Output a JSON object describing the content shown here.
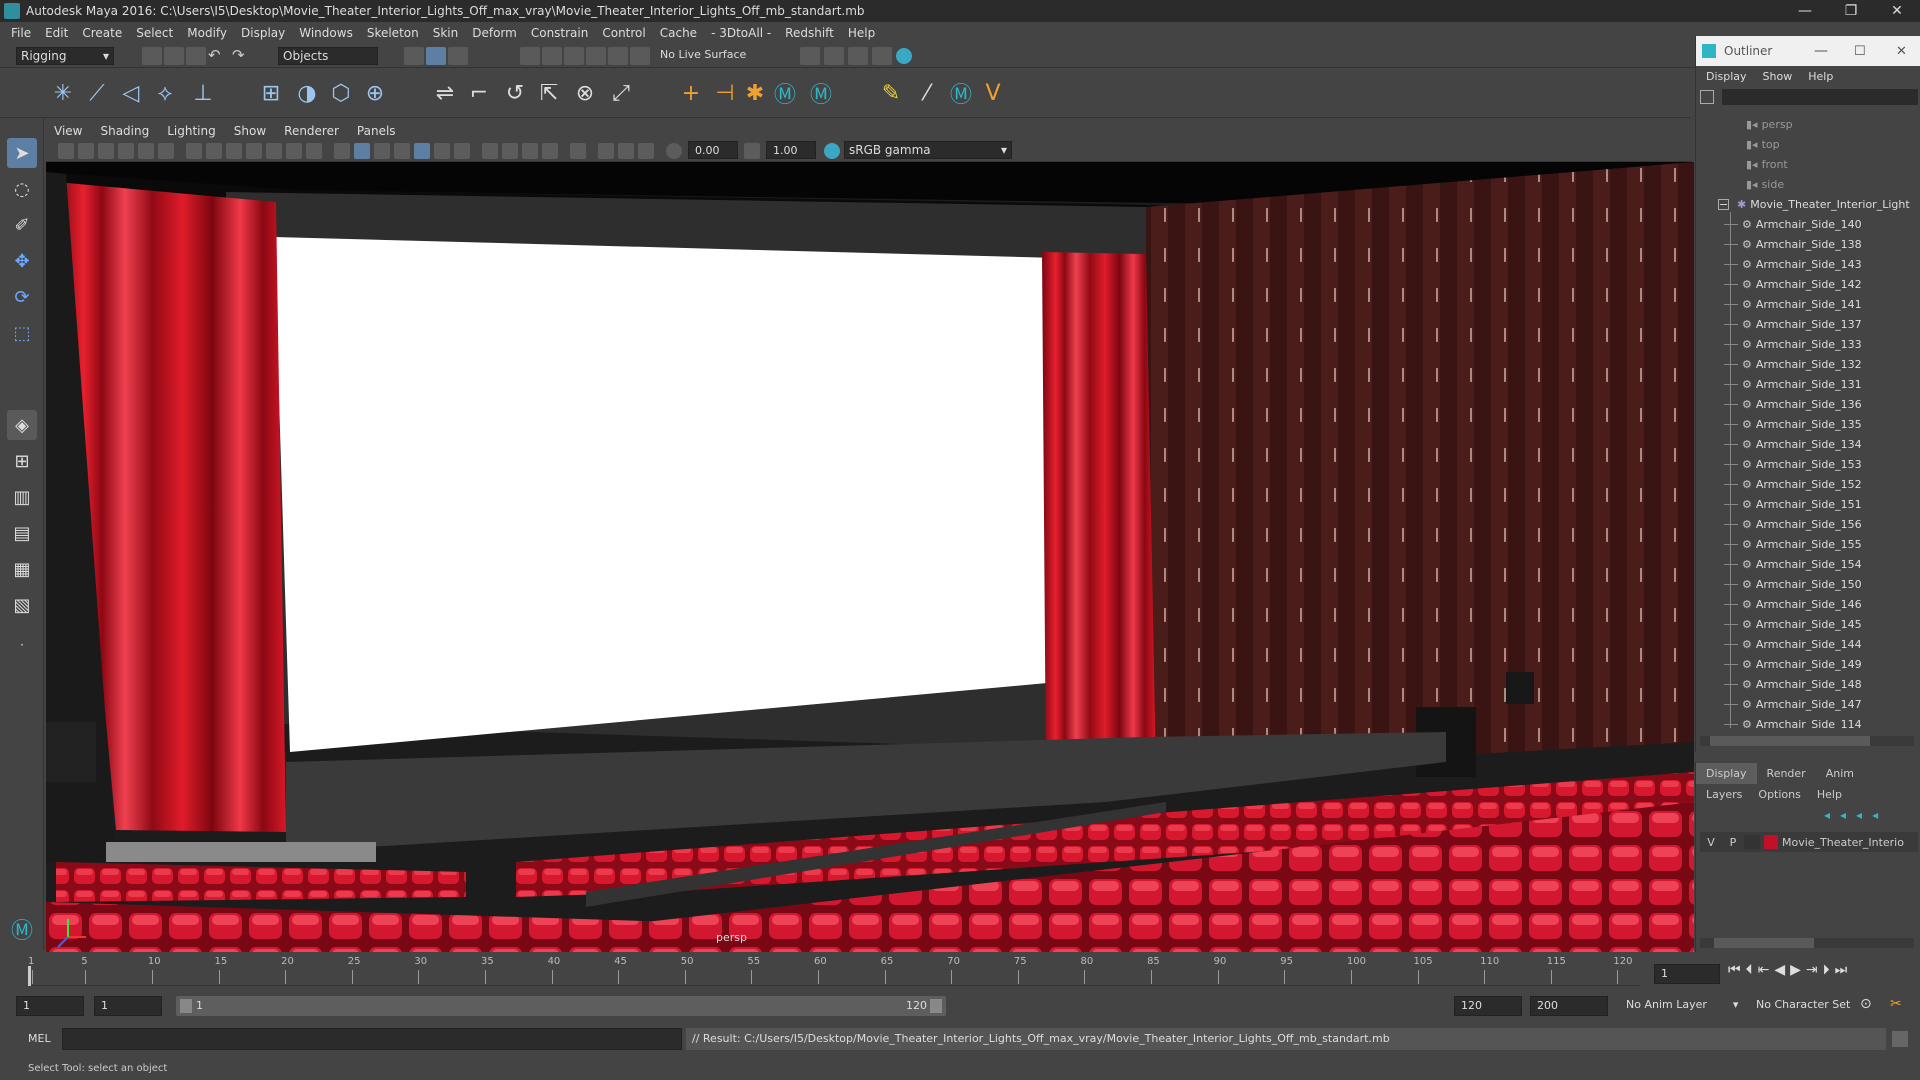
{
  "window": {
    "title": "Autodesk Maya 2016: C:\\Users\\I5\\Desktop\\Movie_Theater_Interior_Lights_Off_max_vray\\Movie_Theater_Interior_Lights_Off_mb_standart.mb",
    "minimize": "—",
    "maximize": "❐",
    "close": "✕"
  },
  "menubar": [
    "File",
    "Edit",
    "Create",
    "Select",
    "Modify",
    "Display",
    "Windows",
    "Skeleton",
    "Skin",
    "Deform",
    "Constrain",
    "Control",
    "Cache",
    "- 3DtoAll -",
    "Redshift",
    "Help"
  ],
  "statusline": {
    "menuset": "Rigging",
    "select_mode": "Objects",
    "live_surface": "No Live Surface"
  },
  "viewport": {
    "menus": [
      "View",
      "Shading",
      "Lighting",
      "Show",
      "Renderer",
      "Panels"
    ],
    "exposure": "0.00",
    "gamma": "1.00",
    "colorspace": "sRGB gamma",
    "camera_label": "persp"
  },
  "outliner": {
    "title": "Outliner",
    "menus": [
      "Display",
      "Show",
      "Help"
    ],
    "cameras": [
      "persp",
      "top",
      "front",
      "side"
    ],
    "group": "Movie_Theater_Interior_Light",
    "children": [
      "Armchair_Side_140",
      "Armchair_Side_138",
      "Armchair_Side_143",
      "Armchair_Side_142",
      "Armchair_Side_141",
      "Armchair_Side_137",
      "Armchair_Side_133",
      "Armchair_Side_132",
      "Armchair_Side_131",
      "Armchair_Side_136",
      "Armchair_Side_135",
      "Armchair_Side_134",
      "Armchair_Side_153",
      "Armchair_Side_152",
      "Armchair_Side_151",
      "Armchair_Side_156",
      "Armchair_Side_155",
      "Armchair_Side_154",
      "Armchair_Side_150",
      "Armchair_Side_146",
      "Armchair_Side_145",
      "Armchair_Side_144",
      "Armchair_Side_149",
      "Armchair_Side_148",
      "Armchair_Side_147",
      "Armchair_Side_114"
    ]
  },
  "layers": {
    "tabs": [
      "Display",
      "Render",
      "Anim"
    ],
    "menus": [
      "Layers",
      "Options",
      "Help"
    ],
    "row": {
      "v": "V",
      "p": "P",
      "name": "Movie_Theater_Interio",
      "color": "#c0102a"
    }
  },
  "timeline": {
    "ticks": [
      "1",
      "5",
      "10",
      "15",
      "20",
      "25",
      "30",
      "35",
      "40",
      "45",
      "50",
      "55",
      "60",
      "65",
      "70",
      "75",
      "80",
      "85",
      "90",
      "95",
      "100",
      "105",
      "110",
      "115",
      "120"
    ],
    "current_frame": "1"
  },
  "range": {
    "start": "1",
    "playback_start": "1",
    "slider_start": "1",
    "slider_end": "120",
    "playback_end": "120",
    "end": "200",
    "anim_layer": "No Anim Layer",
    "character_set": "No Character Set"
  },
  "cmd": {
    "lang": "MEL",
    "result": "// Result: C:/Users/I5/Desktop/Movie_Theater_Interior_Lights_Off_max_vray/Movie_Theater_Interior_Lights_Off_mb_standart.mb"
  },
  "help": "Select Tool: select an object",
  "colors": {
    "seat": "#d0162f",
    "curtain": "#c8101e",
    "wall": "#4a1d1a",
    "screen": "#ffffff"
  }
}
